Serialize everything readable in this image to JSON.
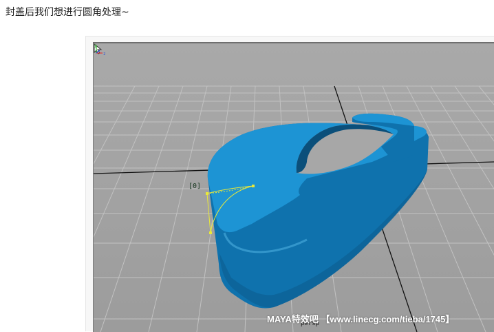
{
  "post": {
    "text": "封盖后我们想进行圆角处理~"
  },
  "viewport": {
    "camera_label": "persp",
    "pivot_label": "[0]",
    "watermark": "MAYA特效吧 【www.linecg.com/tieba/1745】",
    "cursor_icon": "arrow-cursor-icon",
    "axis_icon": "xyz-axis-gizmo-icon",
    "colors": {
      "background": "#a3a3a3",
      "grid": "#c4c4c4",
      "axis_lines": "#111111",
      "model": "#1b8fcc",
      "curve": "#e8e83a"
    }
  }
}
